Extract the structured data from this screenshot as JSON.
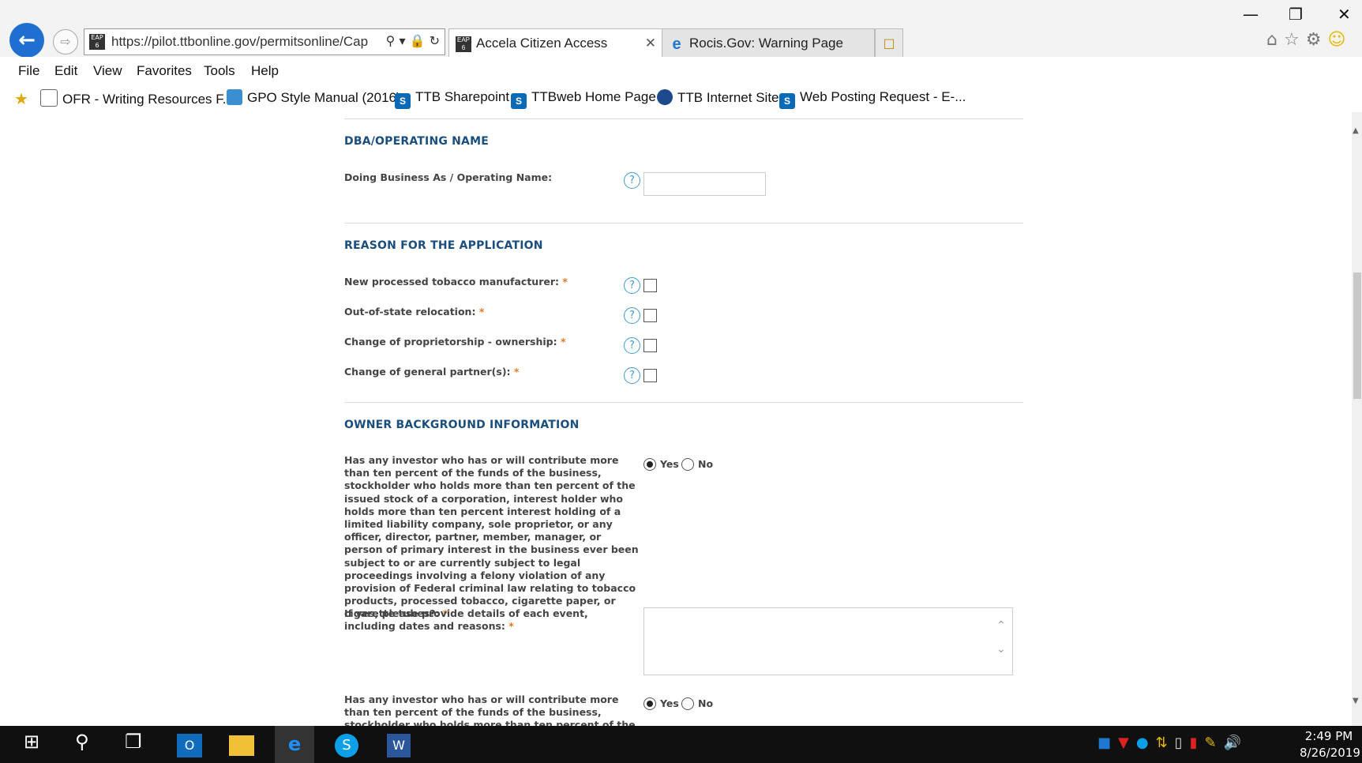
{
  "browser": {
    "url": "https://pilot.ttbonline.gov/permitsonline/Cap",
    "tabs": [
      {
        "label": "Accela Citizen Access",
        "favicon": "accela-icon",
        "active": true
      },
      {
        "label": "Rocis.Gov: Warning Page",
        "favicon": "ie-icon",
        "active": false
      }
    ],
    "menu": [
      "File",
      "Edit",
      "View",
      "Favorites",
      "Tools",
      "Help"
    ],
    "favorites": [
      {
        "label": "OFR - Writing Resources F...",
        "icon": "document-icon"
      },
      {
        "label": "GPO Style Manual (2016)",
        "icon": "gpo-icon"
      },
      {
        "label": "TTB Sharepoint",
        "icon": "sharepoint-icon"
      },
      {
        "label": "TTBweb Home Page",
        "icon": "sharepoint-icon"
      },
      {
        "label": "TTB Internet Site",
        "icon": "ttb-seal-icon"
      },
      {
        "label": "Web Posting Request - E-...",
        "icon": "sharepoint-icon"
      }
    ]
  },
  "form": {
    "dba": {
      "heading": "DBA/OPERATING NAME",
      "label": "Doing Business As / Operating Name:",
      "value": ""
    },
    "reason": {
      "heading": "REASON FOR THE APPLICATION",
      "items": [
        {
          "label": "New processed tobacco manufacturer:",
          "checked": false
        },
        {
          "label": "Out-of-state relocation:",
          "checked": false
        },
        {
          "label": "Change of proprietorship - ownership:",
          "checked": false
        },
        {
          "label": "Change of general partner(s):",
          "checked": false
        }
      ]
    },
    "owner": {
      "heading": "OWNER BACKGROUND INFORMATION",
      "question1": "Has any investor who has or will contribute more than ten percent of the funds of the business, stockholder who holds more than ten percent of the issued stock of a corporation, interest holder who holds more than ten percent interest holding of a limited liability company, sole proprietor, or any officer, director, partner, member, manager, or person of primary interest in the business ever been subject to or are currently subject to legal proceedings involving a felony violation of any provision of Federal criminal law relating to tobacco products, processed tobacco, cigarette paper, or cigarette tubes?:",
      "question1_answer": "Yes",
      "details_label": "If yes, please provide details of each event, including dates and reasons:",
      "details_value": "",
      "question2_partial": "Has any investor who has or will contribute more than ten percent of the funds of the business, stockholder who holds more than ten percent of the issued stock of a corporation",
      "question2_answer": "Yes",
      "yes_label": "Yes",
      "no_label": "No"
    },
    "required_mark": "*"
  },
  "taskbar": {
    "time": "2:49 PM",
    "date": "8/26/2019"
  },
  "colors": {
    "section_heading": "#1a4e7c",
    "required": "#e07a1f",
    "help_icon": "#3d9bd9",
    "ie_blue": "#1e6fd0"
  }
}
